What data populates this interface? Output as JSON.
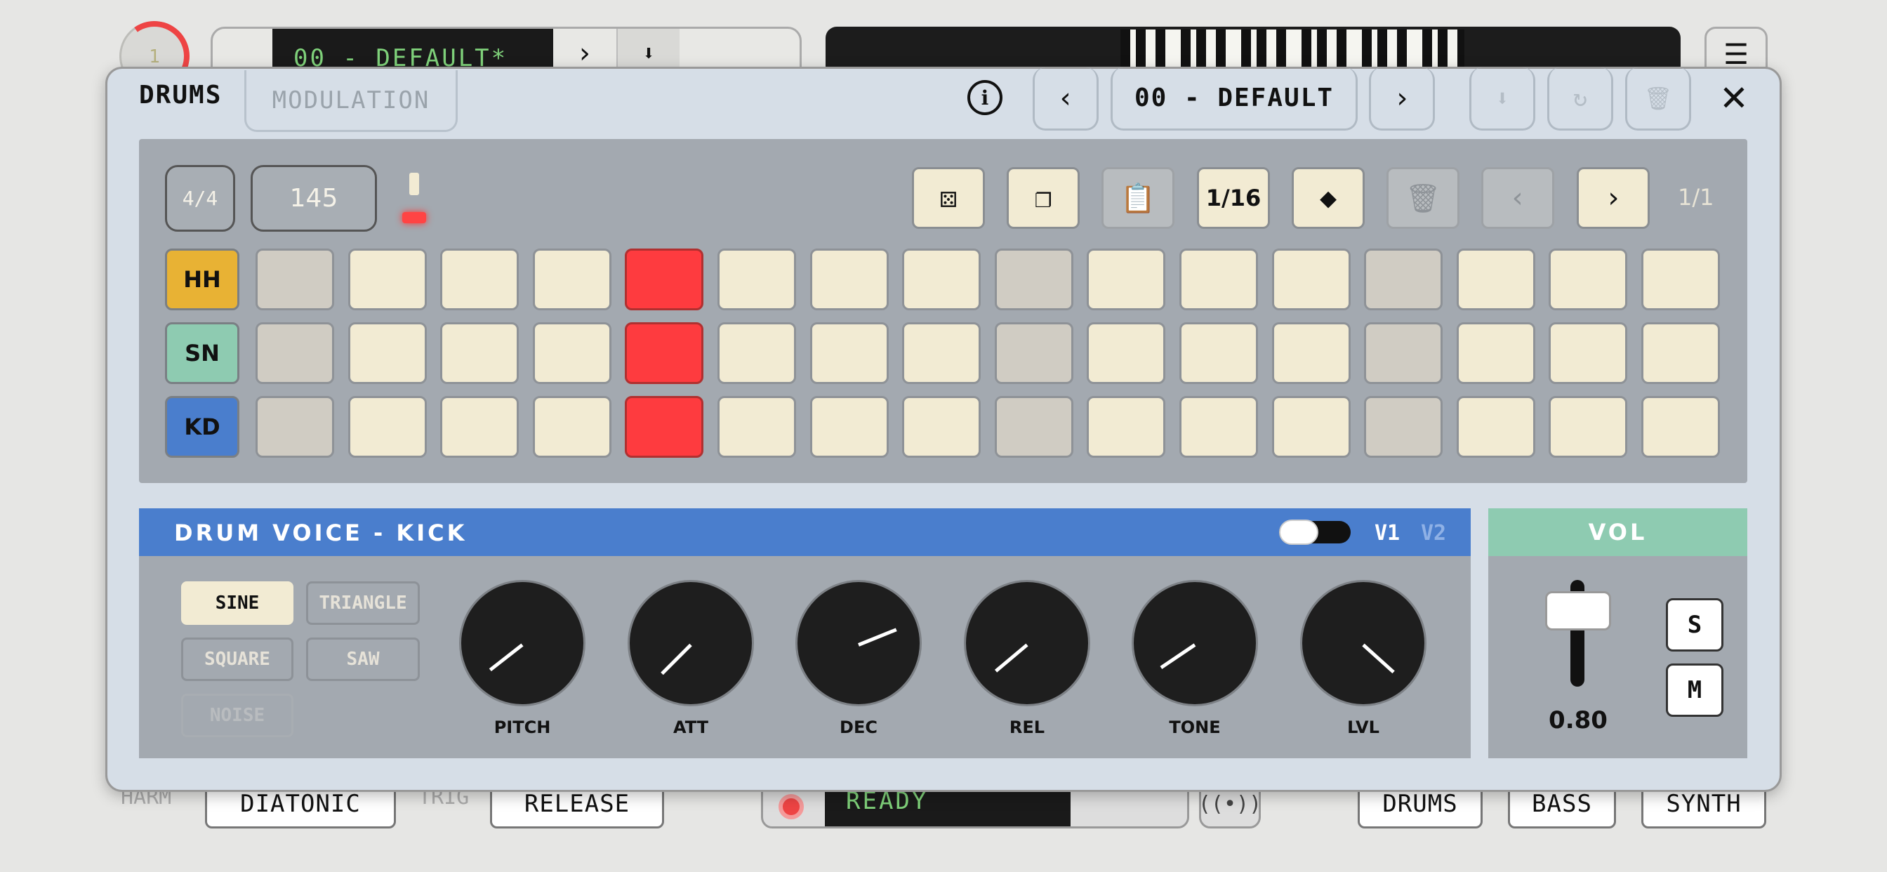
{
  "background": {
    "knob_value": "1",
    "preset_display": "00 - DEFAULT*",
    "bottom": {
      "harm_label": "HARM",
      "harm_value": "DIATONIC",
      "trig_label": "TRIG",
      "trig_value": "RELEASE",
      "transport_display": "READY",
      "engines": [
        "DRUMS",
        "BASS",
        "SYNTH"
      ]
    }
  },
  "modal": {
    "tabs": {
      "active": "DRUMS",
      "inactive": "MODULATION"
    },
    "preset_name": "00 - DEFAULT",
    "sequencer": {
      "time_signature": "4/4",
      "bpm": "145",
      "step_division": "1/16",
      "page": "1/1",
      "tracks": [
        {
          "label": "HH",
          "color": "#e8b234",
          "active_step": 5
        },
        {
          "label": "SN",
          "color": "#8ecbb1",
          "active_step": 5
        },
        {
          "label": "KD",
          "color": "#4a7ecd",
          "active_step": 5
        }
      ],
      "colors": {
        "step_on": "#fe3b3f",
        "step_off": "#f2ebd3",
        "step_beat": "#d0ccc3"
      }
    },
    "voice": {
      "title": "DRUM VOICE - KICK",
      "v1": "V1",
      "v2": "V2",
      "waves": [
        "SINE",
        "TRIANGLE",
        "SQUARE",
        "SAW",
        "NOISE"
      ],
      "selected_wave": "SINE",
      "knobs": [
        {
          "label": "PITCH",
          "angle": 142
        },
        {
          "label": "ATT",
          "angle": 135
        },
        {
          "label": "DEC",
          "angle": -22
        },
        {
          "label": "REL",
          "angle": 140
        },
        {
          "label": "TONE",
          "angle": 146
        },
        {
          "label": "LVL",
          "angle": 42
        }
      ]
    },
    "volume": {
      "title": "VOL",
      "value": "0.80",
      "solo": "S",
      "mute": "M"
    }
  }
}
